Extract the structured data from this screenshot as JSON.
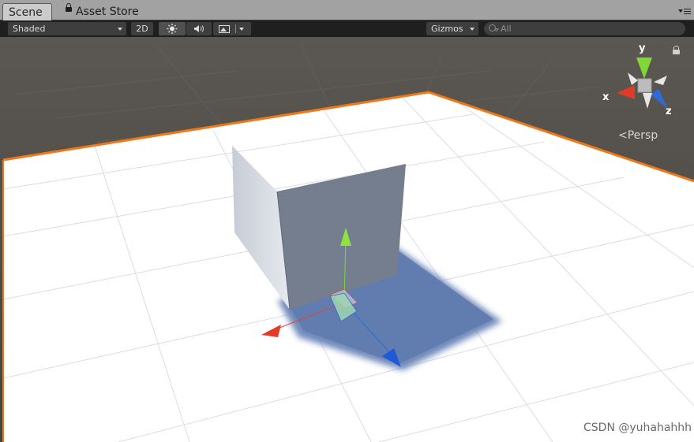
{
  "tabs": [
    {
      "label": "Scene",
      "active": true
    },
    {
      "label": "Asset Store",
      "active": false
    }
  ],
  "toolbar": {
    "draw_mode": "Shaded",
    "mode_2d": "2D",
    "gizmos": "Gizmos",
    "search_placeholder": "All"
  },
  "viewport": {
    "projection_label": "Persp",
    "axes": {
      "x": "x",
      "y": "y",
      "z": "z"
    }
  },
  "watermark": "CSDN @yuhahahhh",
  "colors": {
    "toolbar_bg": "#1f1f1f",
    "tabbar_bg": "#a2a2a2",
    "horizon": "#4e4a45",
    "plane": "#ffffff",
    "selection_outline": "#f07818",
    "axis_x": "#e8422f",
    "axis_y": "#7fd836",
    "axis_z": "#2f6bd8"
  },
  "icons": {
    "lighting": "sun-icon",
    "audio": "speaker-icon",
    "effects": "image-icon",
    "search": "search-icon",
    "lock": "lock-icon",
    "menu": "menu-icon"
  }
}
